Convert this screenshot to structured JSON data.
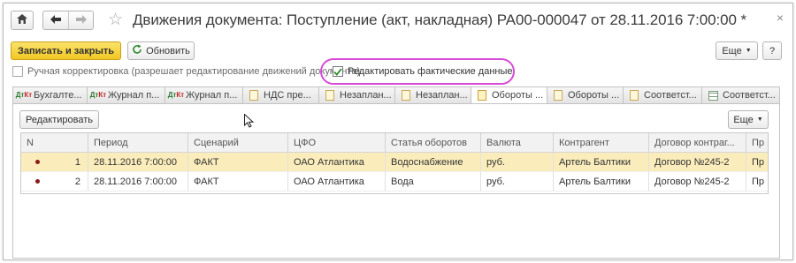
{
  "window": {
    "title": "Движения документа: Поступление (акт, накладная) РА00-000047 от 28.11.2016 7:00:00 *",
    "close_glyph": "×",
    "more_glyph": "⋮"
  },
  "toolbar": {
    "save_close_label": "Записать и закрыть",
    "refresh_label": "Обновить",
    "more_label": "Еще",
    "help_label": "?"
  },
  "options": {
    "manual_correction_label": "Ручная корректировка (разрешает редактирование движений документа)",
    "manual_correction_checked": false,
    "edit_actual_label": "Редактировать фактические данные",
    "edit_actual_checked": true,
    "highlight_color": "#d84ad8"
  },
  "tabs": [
    {
      "label": "Бухгалте...",
      "icon": "dt-kt-icon",
      "active": false
    },
    {
      "label": "Журнал п...",
      "icon": "dt-kt-icon",
      "active": false
    },
    {
      "label": "Журнал п...",
      "icon": "dt-kt-icon",
      "active": false
    },
    {
      "label": "НДС пре...",
      "icon": "register-icon",
      "active": false
    },
    {
      "label": "Незаплан...",
      "icon": "register-icon",
      "active": false
    },
    {
      "label": "Незаплан...",
      "icon": "register-icon",
      "active": false
    },
    {
      "label": "Обороты ...",
      "icon": "register-icon",
      "active": true
    },
    {
      "label": "Обороты ...",
      "icon": "register-icon",
      "active": false
    },
    {
      "label": "Соответст...",
      "icon": "register-icon",
      "active": false
    },
    {
      "label": "Соответст...",
      "icon": "grid-icon",
      "active": false
    }
  ],
  "table_toolbar": {
    "edit_label": "Редактировать",
    "more_label": "Еще"
  },
  "table": {
    "columns": [
      "N",
      "Период",
      "Сценарий",
      "ЦФО",
      "Статья оборотов",
      "Валюта",
      "Контрагент",
      "Договор контраг...",
      "Пр"
    ],
    "rows": [
      {
        "n": "1",
        "period": "28.11.2016 7:00:00",
        "scenario": "ФАКТ",
        "cfo": "ОАО Атлантика",
        "item": "Водоснабжение",
        "currency": "руб.",
        "counterparty": "Артель Балтики",
        "contract": "Договор №245-2",
        "pr": "Пр",
        "selected": true
      },
      {
        "n": "2",
        "period": "28.11.2016 7:00:00",
        "scenario": "ФАКТ",
        "cfo": "ОАО Атлантика",
        "item": "Вода",
        "currency": "руб.",
        "counterparty": "Артель Балтики",
        "contract": "Договор №245-2",
        "pr": "Пр",
        "selected": false
      }
    ]
  },
  "colors": {
    "primary_button": "#f1c722",
    "selected_row": "#fbedbb",
    "row_marker": "#8b1a1a"
  }
}
